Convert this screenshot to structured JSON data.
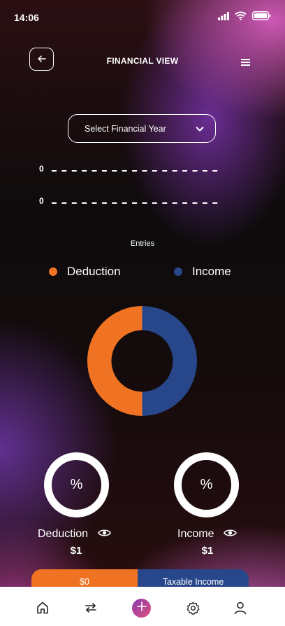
{
  "status_bar": {
    "time": "14:06",
    "icons": [
      "signal-icon",
      "wifi-icon",
      "battery-icon"
    ]
  },
  "header": {
    "title": "FINANCIAL VIEW",
    "back_icon": "arrow-left-icon",
    "menu_icon": "menu-icon"
  },
  "year_select": {
    "label": "Select Financial Year",
    "icon": "chevron-down-icon"
  },
  "axis": {
    "top_label": "0",
    "bottom_label": "0"
  },
  "chart_data": {
    "type": "pie",
    "title": "Entries",
    "donut": true,
    "legend_position": "top",
    "series": [
      {
        "name": "Deduction",
        "value": 1,
        "color": "#f07324"
      },
      {
        "name": "Income",
        "value": 1,
        "color": "#27478a"
      }
    ]
  },
  "rings": [
    {
      "symbol": "%",
      "label": "Deduction",
      "value": "$1",
      "eye_icon": "eye-icon"
    },
    {
      "symbol": "%",
      "label": "Income",
      "value": "$1",
      "eye_icon": "eye-icon"
    }
  ],
  "summary": {
    "left": "$0",
    "right": "Taxable Income",
    "left_color": "#f07324",
    "right_color": "#27478a"
  },
  "bottom_nav": {
    "items": [
      "home-icon",
      "transfer-icon",
      "add-icon",
      "settings-icon",
      "profile-icon"
    ],
    "add_gradient": [
      "#8a3bb0",
      "#e0507e"
    ]
  }
}
